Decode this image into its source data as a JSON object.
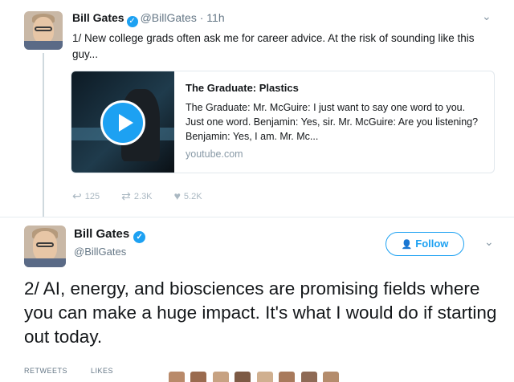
{
  "tweet1": {
    "name": "Bill Gates",
    "handle": "@BillGates",
    "time": "11h",
    "text": "1/ New college grads often ask me for career advice. At the risk of sounding like this guy...",
    "card": {
      "title": "The Graduate: Plastics",
      "description": "The Graduate: Mr. McGuire: I just want to say one word to you. Just one word. Benjamin: Yes, sir. Mr. McGuire: Are you listening? Benjamin: Yes, I am. Mr. Mc...",
      "domain": "youtube.com"
    },
    "actions": {
      "replies": "125",
      "retweets": "2.3K",
      "likes": "5.2K"
    }
  },
  "tweet2": {
    "name": "Bill Gates",
    "handle": "@BillGates",
    "follow_label": "Follow",
    "text": "2/ AI, energy, and biosciences are promising fields where you can make a huge impact. It's what I would do if starting out today.",
    "stats": {
      "retweets_label": "RETWEETS",
      "likes_label": "LIKES"
    }
  },
  "icons": {
    "verified": "verified-badge-icon",
    "reply": "reply-icon",
    "retweet": "retweet-icon",
    "like": "heart-icon",
    "play": "play-icon",
    "chevron": "chevron-down-icon",
    "follow": "add-user-icon"
  },
  "colors": {
    "accent": "#1da1f2",
    "text": "#14171a",
    "muted": "#657786"
  }
}
